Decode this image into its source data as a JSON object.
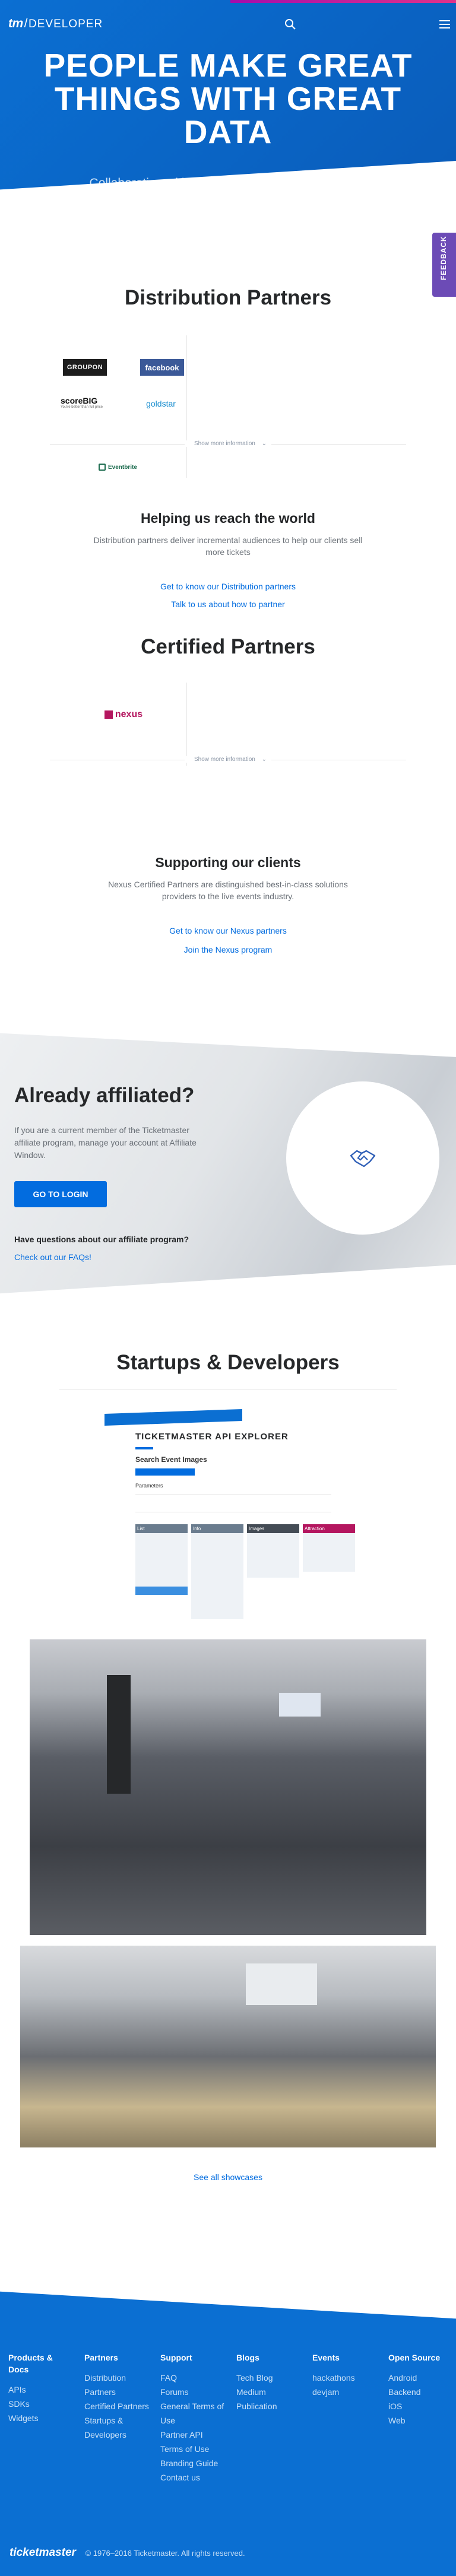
{
  "header": {
    "logo_tm": "tm",
    "logo_sep": "/",
    "logo_dev": "DEVELOPER",
    "search_icon": "search-icon",
    "menu_icon": "hamburger-menu-icon"
  },
  "hero": {
    "title": "PEOPLE MAKE GREAT THINGS WITH GREAT DATA",
    "subtitle": "Collaborating with partners, clients and the startup community to build experiences that"
  },
  "feedback": {
    "label": "FEEDBACK"
  },
  "distribution": {
    "title": "Distribution Partners",
    "logos": [
      "GROUPON",
      "facebook",
      "scoreBIG",
      "goldstar",
      "Eventbrite"
    ],
    "scorebig_tagline": "You're better than full price",
    "show_more": "Show more information",
    "subtitle": "Helping us reach the world",
    "description": "Distribution partners deliver incremental audiences to help our clients sell more tickets",
    "links": [
      "Get to know our Distribution partners",
      "Talk to us about how to partner"
    ]
  },
  "certified": {
    "title": "Certified Partners",
    "logos": [
      "nexus"
    ],
    "show_more": "Show more information",
    "subtitle": "Supporting our clients",
    "description": "Nexus Certified Partners are distinguished best-in-class solutions providers to the live events industry.",
    "links": [
      "Get to know our Nexus partners",
      "Join the Nexus program"
    ]
  },
  "affiliate": {
    "title": "Already affiliated?",
    "text": "If you are a current member of the Ticketmaster affiliate program, manage your account at Affiliate Window.",
    "login_button": "GO TO LOGIN",
    "question": "Have questions about our affiliate program?",
    "faq_link": "Check out our FAQs!"
  },
  "startups": {
    "title": "Startups & Developers",
    "api_explorer": {
      "heading": "TICKETMASTER API EXPLORER",
      "sub_heading": "Search Event Images",
      "parameters_label": "Parameters",
      "panels": [
        "List",
        "Info",
        "Images",
        "Attraction"
      ]
    },
    "see_all": "See all showcases"
  },
  "footer": {
    "columns": [
      {
        "title": "Products & Docs",
        "items": [
          "APIs",
          "SDKs",
          "Widgets"
        ]
      },
      {
        "title": "Partners",
        "items": [
          "Distribution Partners",
          "Certified Partners",
          "Startups & Developers"
        ]
      },
      {
        "title": "Support",
        "items": [
          "FAQ",
          "Forums",
          "General Terms of Use",
          "Partner API Terms of Use",
          "Branding Guide",
          "Contact us"
        ]
      },
      {
        "title": "Blogs",
        "items": [
          "Tech Blog",
          "Medium",
          "Publication"
        ]
      },
      {
        "title": "Events",
        "items": [
          "hackathons",
          "devjam"
        ]
      },
      {
        "title": "Open Source",
        "items": [
          "Android",
          "Backend",
          "iOS",
          "Web"
        ]
      }
    ],
    "brand": "ticketmaster",
    "copyright": "© 1976–2016 Ticketmaster. All rights reserved."
  },
  "colors": {
    "brand_blue": "#026cdf",
    "hero_blue": "#0b6fd2",
    "feedback_purple": "#6c4bb6"
  }
}
